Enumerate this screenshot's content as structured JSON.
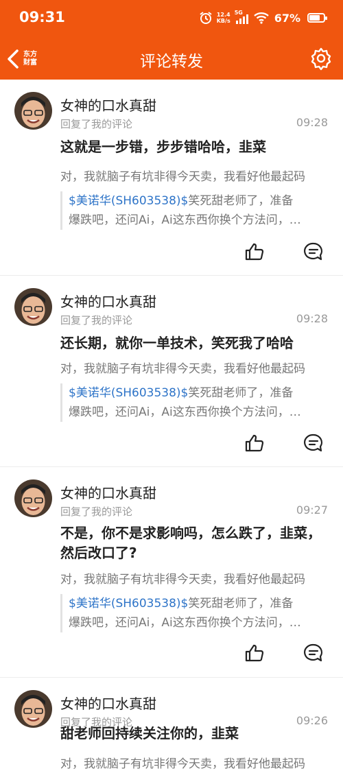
{
  "status": {
    "time": "09:31",
    "net_speed": "12.4",
    "net_unit": "KB/s",
    "signal": "5G",
    "battery": "67%",
    "battery_level": 0.67
  },
  "nav": {
    "title": "评论转发",
    "logo_line1": "东方",
    "logo_line2": "财富"
  },
  "comments": [
    {
      "user": "女神的口水真甜",
      "type": "回复了我的评论",
      "time": "09:28",
      "text": "这就是一步错，步步错哈哈，韭菜",
      "original": "对，我就脑子有坑非得今天卖，我看好他最起码",
      "quote_stock": "$美诺华(SH603538)$",
      "quote_rest": "笑死甜老师了，准备",
      "quote_line2": "爆跌吧，还问Ai，Ai这东西你换个方法问，…"
    },
    {
      "user": "女神的口水真甜",
      "type": "回复了我的评论",
      "time": "09:28",
      "text": "还长期，就你一单技术，笑死我了哈哈",
      "original": "对，我就脑子有坑非得今天卖，我看好他最起码",
      "quote_stock": "$美诺华(SH603538)$",
      "quote_rest": "笑死甜老师了，准备",
      "quote_line2": "爆跌吧，还问Ai，Ai这东西你换个方法问，…"
    },
    {
      "user": "女神的口水真甜",
      "type": "回复了我的评论",
      "time": "09:27",
      "text": "不是，你不是求影响吗，怎么跌了，韭菜，然后改口了?",
      "original": "对，我就脑子有坑非得今天卖，我看好他最起码",
      "quote_stock": "$美诺华(SH603538)$",
      "quote_rest": "笑死甜老师了，准备",
      "quote_line2": "爆跌吧，还问Ai，Ai这东西你换个方法问，…"
    },
    {
      "user": "女神的口水真甜",
      "type": "回复了我的评论",
      "time": "09:26",
      "text": "甜老师回持续关注你的，韭菜",
      "original": "对，我就脑子有坑非得今天卖，我看好他最起码"
    }
  ],
  "colors": {
    "brand": "#f0560f",
    "link": "#2e74c8"
  },
  "icons": {
    "back": "chevron-left-icon",
    "settings": "gear-icon",
    "like": "thumbs-up-icon",
    "reply": "comment-icon"
  }
}
